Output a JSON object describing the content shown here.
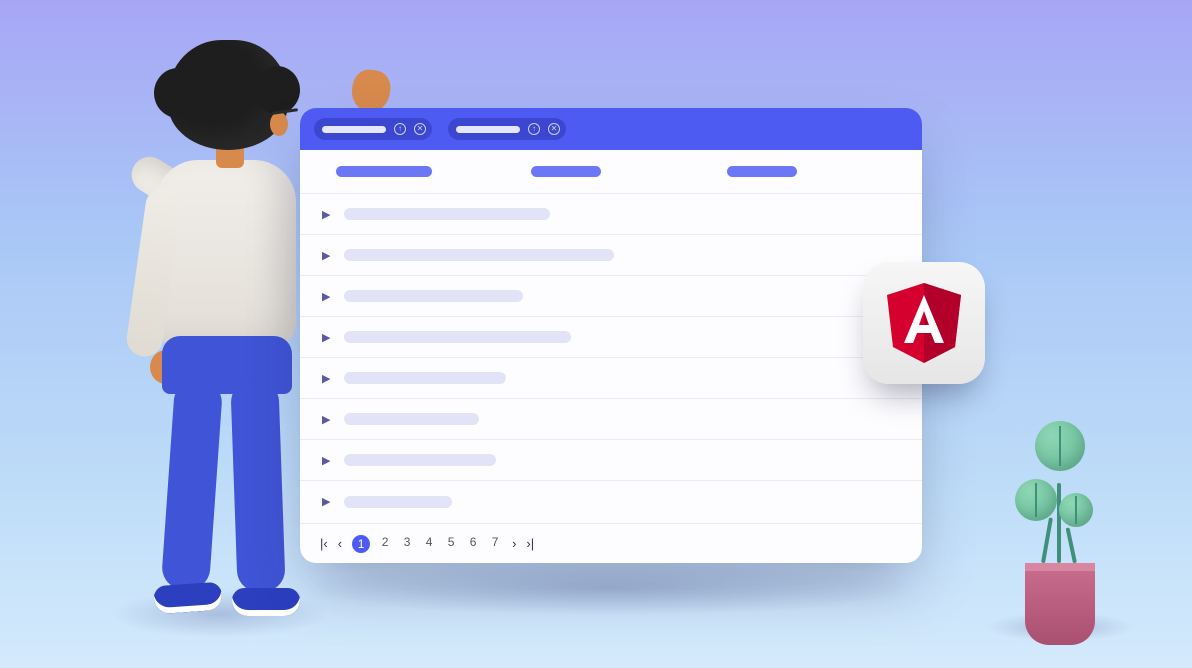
{
  "toolbar": {
    "group_chips": [
      {
        "sort_icon": "arrow-up-icon",
        "remove_icon": "close-icon"
      },
      {
        "sort_icon": "arrow-up-icon",
        "remove_icon": "close-icon"
      }
    ]
  },
  "grid": {
    "columns": 3,
    "row_widths_pct": [
      38,
      50,
      33,
      42,
      30,
      25,
      28,
      20
    ],
    "total_rows": 8
  },
  "pager": {
    "first": "|‹",
    "prev": "‹",
    "next": "›",
    "last": "›|",
    "current": 1,
    "pages": [
      1,
      2,
      3,
      4,
      5,
      6,
      7
    ]
  },
  "badge": {
    "name": "angular-logo",
    "letter": "A",
    "shield_color": "#d6002f",
    "shield_inner": "#b3002a"
  },
  "colors": {
    "primary": "#4e5bf2",
    "primary_dark": "#3c47d1",
    "row_bar": "#e3e3f8"
  }
}
